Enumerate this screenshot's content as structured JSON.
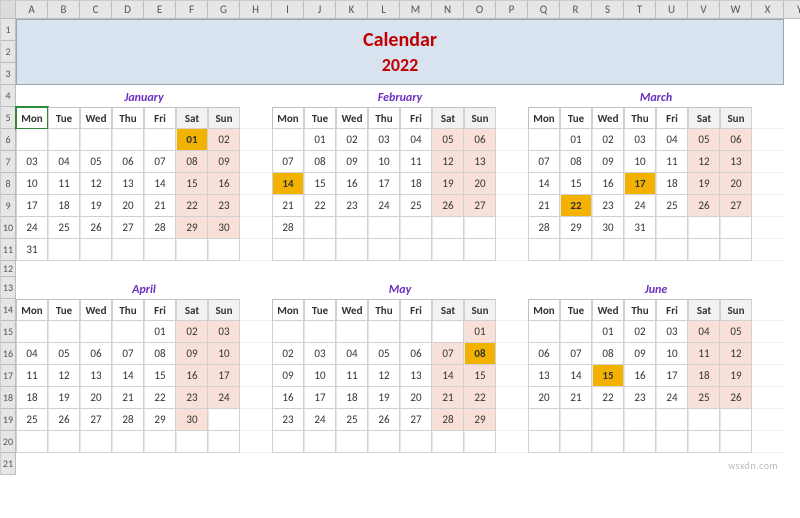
{
  "columns": [
    "A",
    "B",
    "C",
    "D",
    "E",
    "F",
    "G",
    "H",
    "I",
    "J",
    "K",
    "L",
    "M",
    "N",
    "O",
    "P",
    "Q",
    "R",
    "S",
    "T",
    "U",
    "V",
    "W",
    "X",
    "Y"
  ],
  "rows": [
    1,
    2,
    3,
    4,
    5,
    6,
    7,
    8,
    9,
    10,
    11,
    12,
    13,
    14,
    15,
    16,
    17,
    18,
    19,
    20,
    21
  ],
  "title": {
    "line1": "Calendar",
    "line2": "2022"
  },
  "selected_cell": "B5",
  "dow": [
    "Mon",
    "Tue",
    "Wed",
    "Thu",
    "Fri",
    "Sat",
    "Sun"
  ],
  "months": [
    {
      "name": "January",
      "weeks": [
        [
          "",
          "",
          "",
          "",
          "",
          "01",
          "02"
        ],
        [
          "03",
          "04",
          "05",
          "06",
          "07",
          "08",
          "09"
        ],
        [
          "10",
          "11",
          "12",
          "13",
          "14",
          "15",
          "16"
        ],
        [
          "17",
          "18",
          "19",
          "20",
          "21",
          "22",
          "23"
        ],
        [
          "24",
          "25",
          "26",
          "27",
          "28",
          "29",
          "30"
        ],
        [
          "31",
          "",
          "",
          "",
          "",
          "",
          ""
        ]
      ],
      "highlights": [
        "01"
      ]
    },
    {
      "name": "February",
      "weeks": [
        [
          "",
          "01",
          "02",
          "03",
          "04",
          "05",
          "06"
        ],
        [
          "07",
          "08",
          "09",
          "10",
          "11",
          "12",
          "13"
        ],
        [
          "14",
          "15",
          "16",
          "17",
          "18",
          "19",
          "20"
        ],
        [
          "21",
          "22",
          "23",
          "24",
          "25",
          "26",
          "27"
        ],
        [
          "28",
          "",
          "",
          "",
          "",
          "",
          ""
        ],
        [
          "",
          "",
          "",
          "",
          "",
          "",
          ""
        ]
      ],
      "highlights": [
        "14"
      ]
    },
    {
      "name": "March",
      "weeks": [
        [
          "",
          "01",
          "02",
          "03",
          "04",
          "05",
          "06"
        ],
        [
          "07",
          "08",
          "09",
          "10",
          "11",
          "12",
          "13"
        ],
        [
          "14",
          "15",
          "16",
          "17",
          "18",
          "19",
          "20"
        ],
        [
          "21",
          "22",
          "23",
          "24",
          "25",
          "26",
          "27"
        ],
        [
          "28",
          "29",
          "30",
          "31",
          "",
          "",
          ""
        ],
        [
          "",
          "",
          "",
          "",
          "",
          "",
          ""
        ]
      ],
      "highlights": [
        "17",
        "22"
      ]
    },
    {
      "name": "April",
      "weeks": [
        [
          "",
          "",
          "",
          "",
          "01",
          "02",
          "03"
        ],
        [
          "04",
          "05",
          "06",
          "07",
          "08",
          "09",
          "10"
        ],
        [
          "11",
          "12",
          "13",
          "14",
          "15",
          "16",
          "17"
        ],
        [
          "18",
          "19",
          "20",
          "21",
          "22",
          "23",
          "24"
        ],
        [
          "25",
          "26",
          "27",
          "28",
          "29",
          "30",
          ""
        ],
        [
          "",
          "",
          "",
          "",
          "",
          "",
          ""
        ]
      ],
      "highlights": []
    },
    {
      "name": "May",
      "weeks": [
        [
          "",
          "",
          "",
          "",
          "",
          "",
          "01"
        ],
        [
          "02",
          "03",
          "04",
          "05",
          "06",
          "07",
          "08"
        ],
        [
          "09",
          "10",
          "11",
          "12",
          "13",
          "14",
          "15"
        ],
        [
          "16",
          "17",
          "18",
          "19",
          "20",
          "21",
          "22"
        ],
        [
          "23",
          "24",
          "25",
          "26",
          "27",
          "28",
          "29"
        ],
        [
          "",
          "",
          "",
          "",
          "",
          "",
          ""
        ]
      ],
      "highlights": [
        "08"
      ]
    },
    {
      "name": "June",
      "weeks": [
        [
          "",
          "",
          "01",
          "02",
          "03",
          "04",
          "05"
        ],
        [
          "06",
          "07",
          "08",
          "09",
          "10",
          "11",
          "12"
        ],
        [
          "13",
          "14",
          "15",
          "16",
          "17",
          "18",
          "19"
        ],
        [
          "20",
          "21",
          "22",
          "23",
          "24",
          "25",
          "26"
        ],
        [
          "",
          "",
          "",
          "",
          "",
          "",
          ""
        ],
        [
          "",
          "",
          "",
          "",
          "",
          "",
          ""
        ]
      ],
      "highlights": [
        "15"
      ]
    }
  ],
  "watermark": "wsxdn.com"
}
